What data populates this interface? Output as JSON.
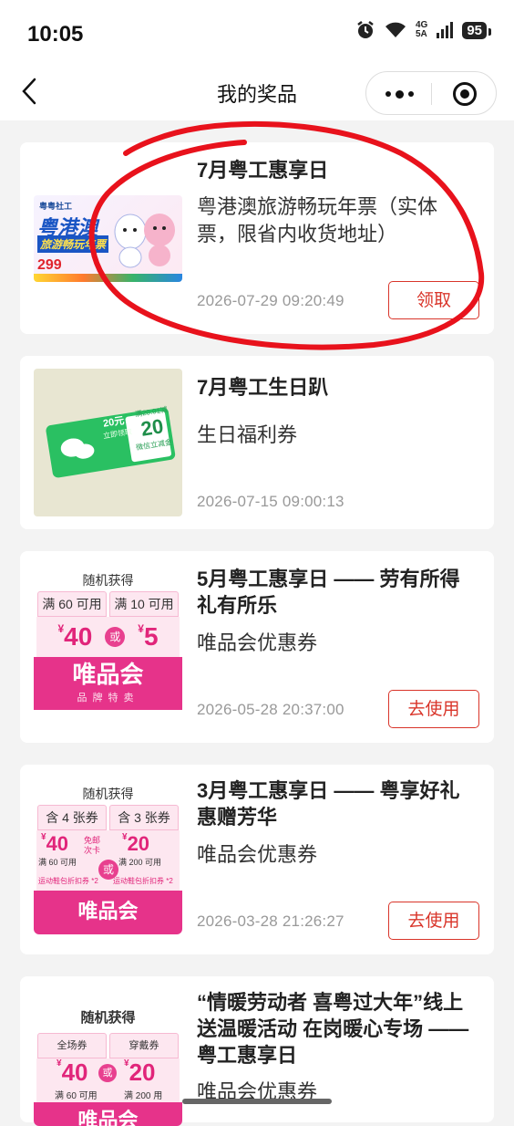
{
  "status": {
    "time": "10:05",
    "network_top": "4G",
    "network_bottom": "5A",
    "battery": "95"
  },
  "nav": {
    "title": "我的奖品"
  },
  "prizes": [
    {
      "title": "7月粤工惠享日",
      "desc": "粤港澳旅游畅玩年票（实体票，限省内收货地址）",
      "date": "2026-07-29 09:20:49",
      "action": "领取",
      "thumb": {
        "badge": "粤港澳",
        "sub": "旅游畅玩年票",
        "price": "299",
        "brand": "粤粤社工"
      }
    },
    {
      "title": "7月粤工生日趴",
      "desc": "生日福利券",
      "date": "2026-07-15 09:00:13",
      "thumb": {
        "small": "20元",
        "small_sub": "立即领取",
        "cond": "满20.01减",
        "amount": "20",
        "label": "微信立减金"
      }
    },
    {
      "title": "5月粤工惠享日 —— 劳有所得 礼有所乐",
      "desc": "唯品会优惠券",
      "date": "2026-05-28 20:37:00",
      "action": "去使用",
      "thumb": {
        "top": "随机获得",
        "box1": "满 60 可用",
        "box2": "满 10 可用",
        "amount1": "40",
        "amount2": "5",
        "or": "或",
        "brand": "唯品会",
        "sub": "品牌特卖"
      }
    },
    {
      "title": "3月粤工惠享日 —— 粤享好礼 惠赠芳华",
      "desc": "唯品会优惠券",
      "date": "2026-03-28 21:26:27",
      "action": "去使用",
      "thumb": {
        "top": "随机获得",
        "box1": "含 4 张券",
        "box2": "含 3 张券",
        "amount1": "40",
        "cond1": "满 60 可用",
        "extra1": "免邮次卡",
        "amount2": "20",
        "cond2": "满 200 可用",
        "foot1": "运动鞋包折扣券 *2",
        "foot2": "运动鞋包折扣券 *2",
        "or": "或",
        "brand": "唯品会"
      }
    },
    {
      "title": "“情暖劳动者 喜粤过大年”线上送温暖活动 在岗暖心专场 —— 粤工惠享日",
      "desc": "唯品会优惠券",
      "thumb": {
        "top": "随机获得",
        "box1": "全场券",
        "box2": "穿戴券",
        "amount1": "40",
        "cond1": "满 60 可用",
        "amount2": "20",
        "cond2": "满 200 用",
        "or": "或",
        "brand": "唯品会"
      }
    }
  ],
  "colors": {
    "accent": "#d9352a",
    "vip_pink": "#e6338a",
    "annotation": "#e8121c"
  }
}
